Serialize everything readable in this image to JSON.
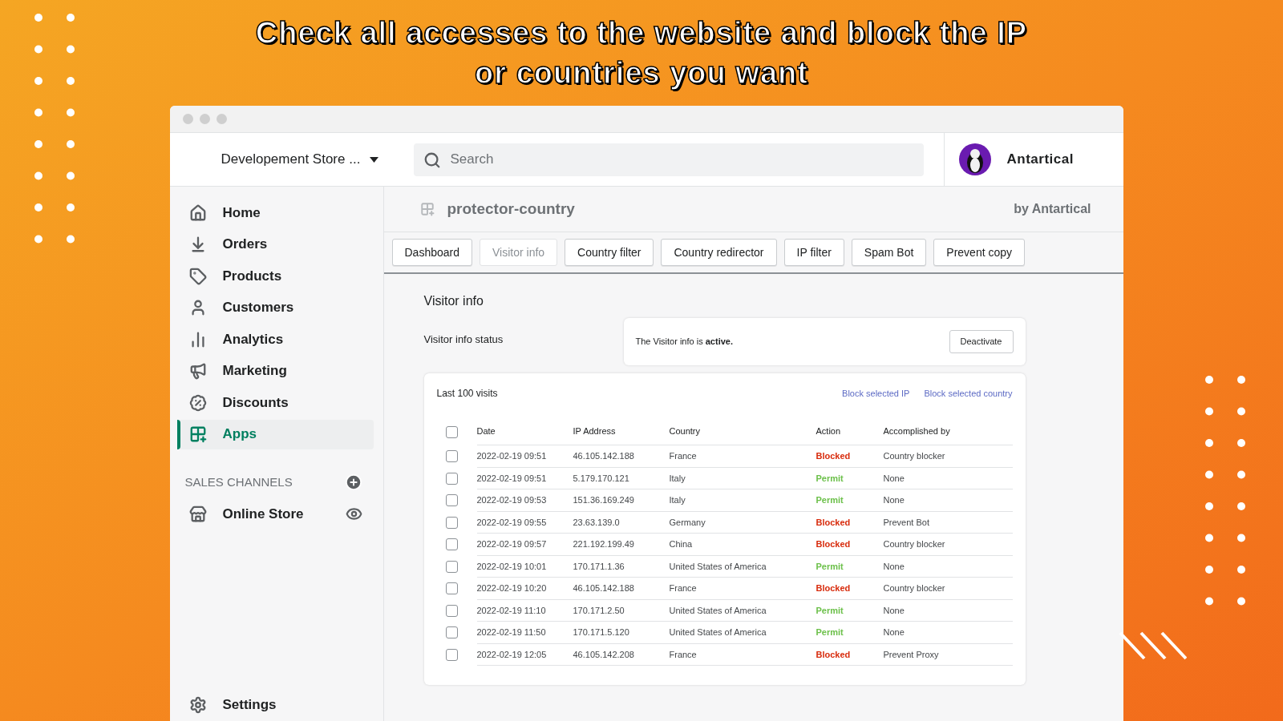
{
  "headline": "Check all accesses to the website and block the IP or countries you want",
  "topbar": {
    "store": "Developement Store ...",
    "search": {
      "placeholder": "Search"
    },
    "user": "Antartical"
  },
  "sidebar": {
    "items": [
      {
        "label": "Home",
        "selected": false
      },
      {
        "label": "Orders",
        "selected": false
      },
      {
        "label": "Products",
        "selected": false
      },
      {
        "label": "Customers",
        "selected": false
      },
      {
        "label": "Analytics",
        "selected": false
      },
      {
        "label": "Marketing",
        "selected": false
      },
      {
        "label": "Discounts",
        "selected": false
      },
      {
        "label": "Apps",
        "selected": true
      }
    ],
    "sales_channels": {
      "heading": "SALES CHANNELS",
      "items": [
        {
          "label": "Online Store"
        }
      ]
    },
    "settings": "Settings"
  },
  "app": {
    "title": "protector-country",
    "vendor": "by Antartical",
    "tabs": [
      {
        "label": "Dashboard",
        "selected": false
      },
      {
        "label": "Visitor info",
        "selected": true
      },
      {
        "label": "Country filter",
        "selected": false
      },
      {
        "label": "Country redirector",
        "selected": false
      },
      {
        "label": "IP filter",
        "selected": false
      },
      {
        "label": "Spam Bot",
        "selected": false
      },
      {
        "label": "Prevent copy",
        "selected": false
      }
    ],
    "section_title": "Visitor info",
    "status_label": "Visitor info status",
    "status_text": "The Visitor info is **active.**",
    "status_button": "Deactivate",
    "table": {
      "title": "Last 100 visits",
      "links": [
        "Block selected IP",
        "Block selected country"
      ],
      "columns": [
        "Date",
        "IP Address",
        "Country",
        "Action",
        "Accomplished by"
      ],
      "all_checked": false,
      "rows": [
        {
          "checked": false,
          "date": "2022-02-19 09:51",
          "ip": "46.105.142.188",
          "country": "France",
          "action": "Blocked",
          "kind": "blocked",
          "by": "Country blocker"
        },
        {
          "checked": false,
          "date": "2022-02-19 09:51",
          "ip": "5.179.170.121",
          "country": "Italy",
          "action": "Permit",
          "kind": "permit",
          "by": "None"
        },
        {
          "checked": false,
          "date": "2022-02-19 09:53",
          "ip": "151.36.169.249",
          "country": "Italy",
          "action": "Permit",
          "kind": "permit",
          "by": "None"
        },
        {
          "checked": false,
          "date": "2022-02-19 09:55",
          "ip": "23.63.139.0",
          "country": "Germany",
          "action": "Blocked",
          "kind": "blocked",
          "by": "Prevent Bot"
        },
        {
          "checked": false,
          "date": "2022-02-19 09:57",
          "ip": "221.192.199.49",
          "country": "China",
          "action": "Blocked",
          "kind": "blocked",
          "by": "Country blocker"
        },
        {
          "checked": false,
          "date": "2022-02-19 10:01",
          "ip": "170.171.1.36",
          "country": "United States of America",
          "action": "Permit",
          "kind": "permit",
          "by": "None"
        },
        {
          "checked": false,
          "date": "2022-02-19 10:20",
          "ip": "46.105.142.188",
          "country": "France",
          "action": "Blocked",
          "kind": "blocked",
          "by": "Country blocker"
        },
        {
          "checked": false,
          "date": "2022-02-19 11:10",
          "ip": "170.171.2.50",
          "country": "United States of America",
          "action": "Permit",
          "kind": "permit",
          "by": "None"
        },
        {
          "checked": false,
          "date": "2022-02-19 11:50",
          "ip": "170.171.5.120",
          "country": "United States of America",
          "action": "Permit",
          "kind": "permit",
          "by": "None"
        },
        {
          "checked": false,
          "date": "2022-02-19 12:05",
          "ip": "46.105.142.208",
          "country": "France",
          "action": "Blocked",
          "kind": "blocked",
          "by": "Prevent Proxy"
        }
      ]
    }
  }
}
